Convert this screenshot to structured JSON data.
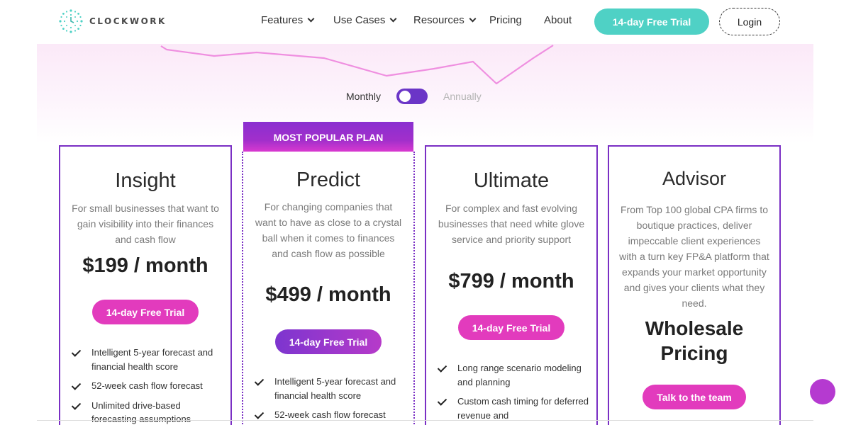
{
  "brand": {
    "name": "CLOCKWORK",
    "color": "#4fd1c5"
  },
  "nav": {
    "items": [
      {
        "label": "Features",
        "dropdown": true
      },
      {
        "label": "Use Cases",
        "dropdown": true
      },
      {
        "label": "Resources",
        "dropdown": true
      },
      {
        "label": "Pricing",
        "dropdown": false
      },
      {
        "label": "About",
        "dropdown": false
      }
    ],
    "trial_label": "14-day Free Trial",
    "login_label": "Login"
  },
  "billing": {
    "monthly": "Monthly",
    "annually": "Annually",
    "selected": "Monthly"
  },
  "popular_banner": "MOST POPULAR PLAN",
  "plans": [
    {
      "title": "Insight",
      "description": "For small businesses that want to gain visibility into their finances and cash flow",
      "price": "$199 / month",
      "cta": "14-day Free Trial",
      "features": [
        "Intelligent 5-year forecast and financial health score",
        "52-week cash flow forecast",
        "Unlimited drive-based forecasting assumptions"
      ]
    },
    {
      "title": "Predict",
      "description": "For changing companies that want to have as close to a crystal ball when it comes to finances and cash flow as possible",
      "price": "$499 / month",
      "cta": "14-day Free Trial",
      "features": [
        "Intelligent 5-year forecast and financial health score",
        "52-week cash flow forecast"
      ]
    },
    {
      "title": "Ultimate",
      "description": "For complex and fast evolving businesses that need white glove service and priority support",
      "price": "$799 / month",
      "cta": "14-day Free Trial",
      "features": [
        "Long range scenario modeling and planning",
        "Custom cash timing for deferred revenue and"
      ]
    },
    {
      "title": "Advisor",
      "description": "From Top 100 global CPA firms to boutique practices, deliver impeccable client experiences with a turn key FP&A platform that expands your market opportunity and gives your clients what they need.",
      "price_line1": "Wholesale",
      "price_line2": "Pricing",
      "cta": "Talk to the team"
    }
  ],
  "colors": {
    "accent_purple": "#7a2fc4",
    "accent_pink": "#e23bbd",
    "teal": "#4fd1c5"
  }
}
